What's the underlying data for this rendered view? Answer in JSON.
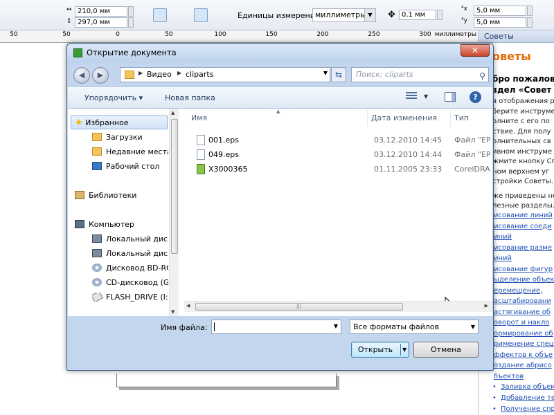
{
  "propbar": {
    "width": "210,0 мм",
    "height": "297,0 мм",
    "units_label": "Единицы измерения:",
    "units_value": "миллиметры",
    "nudge": "0,1 мм",
    "dup_x": "5,0 мм",
    "dup_y": "5,0 мм"
  },
  "ruler": {
    "numbers": [
      "50",
      "0",
      "50",
      "100",
      "150",
      "200",
      "250",
      "300"
    ],
    "unit": "миллиметры"
  },
  "docker": {
    "tab": "Советы",
    "heading": "оветы",
    "sub": [
      "бро пожалов",
      "здел «Совет"
    ],
    "body": [
      "я отображения р",
      "берите инструме",
      "олните с его по",
      "ствие. Для полу",
      "олнительных св",
      "ивном инструме",
      "жмите кнопку Сп",
      "ном верхнем уг",
      "стройки Советы.",
      "",
      "же приведены не",
      "лезные разделы."
    ],
    "links": [
      "исование линий",
      "исование соеди",
      "иний",
      "исование разме",
      "иний",
      "исование фигур",
      "ыделение объек",
      "еремещение,",
      "асштабировани",
      "астягивание об",
      "оворот и накло",
      "ормирование об",
      "рименение спец",
      "ффектов к объе",
      "оздание абрисо",
      "бъектов"
    ],
    "bullets": [
      "Заливка объекто",
      "Добавление текс",
      "Получение справ"
    ]
  },
  "dialog": {
    "title": "Открытие документа",
    "close_glyph": "✕",
    "address": [
      "Видео",
      "cliparts"
    ],
    "search_placeholder": "Поиск: cliparts",
    "toolbar": {
      "organize": "Упорядочить ▾",
      "new_folder": "Новая папка"
    },
    "nav": {
      "favorites": "Избранное",
      "favorites_items": [
        "Загрузки",
        "Недавние места",
        "Рабочий стол"
      ],
      "libraries": "Библиотеки",
      "computer": "Компьютер",
      "computer_items": [
        "Локальный диск",
        "Локальный диск",
        "Дисковод BD-RO",
        "CD-дисковод (G:",
        "FLASH_DRIVE (I:)"
      ]
    },
    "columns": {
      "name": "Имя",
      "date": "Дата изменения",
      "type": "Тип"
    },
    "files": [
      {
        "name": "001.eps",
        "date": "03.12.2010 14:45",
        "type": "Файл \"EP"
      },
      {
        "name": "049.eps",
        "date": "03.12.2010 14:44",
        "type": "Файл \"EP"
      },
      {
        "name": "X3000365",
        "date": "01.11.2005 23:33",
        "type": "CorelDRA"
      }
    ],
    "filename_label": "Имя файла:",
    "filename_value": "",
    "filter": "Все форматы файлов",
    "open_button": "Открыть",
    "cancel_button": "Отмена"
  },
  "colors": {
    "dialog_frame": "#c4d6ee",
    "selection": "#d1e3f8",
    "link": "#1f4fb5",
    "docker_heading": "#e36c00"
  }
}
